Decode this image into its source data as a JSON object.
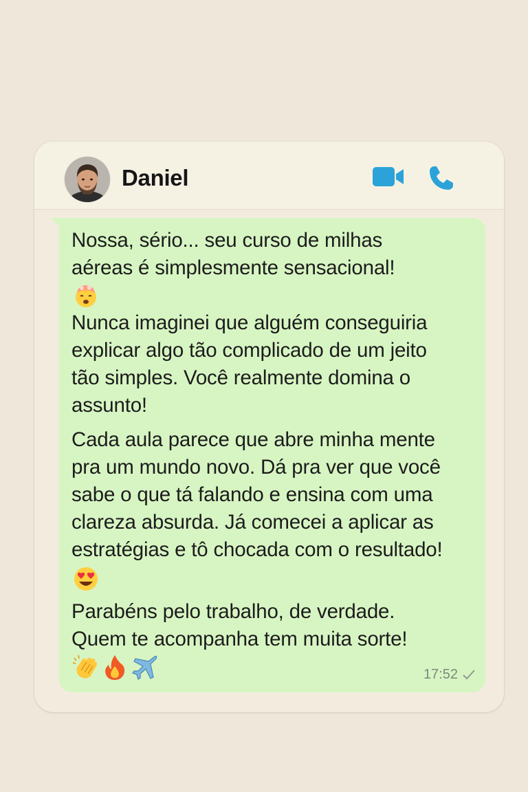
{
  "contact": {
    "name": "Daniel"
  },
  "message": {
    "paragraph_1": "Nossa, sério... seu curso de milhas\naéreas é simplesmente sensacional!\n\nNunca imaginei que alguém conseguiria\nexplicar algo tão complicado de um jeito\ntão simples. Você realmente domina o\nassunto!",
    "paragraph_2": "Cada aula parece que abre minha mente\npra um mundo novo. Dá pra ver que você\nsabe o que tá falando e ensina com uma\nclareza absurda. Já comecei a aplicar as\nestratégias e tô chocada com o resultado!",
    "paragraph_3": "Parabéns pelo trabalho, de verdade.\nQuem te acompanha tem muita sorte!",
    "time": "17:52"
  },
  "icons": {
    "video": "video-camera-icon",
    "call": "phone-icon",
    "tick": "single-check-icon",
    "emoji_1": "exploding-head-emoji",
    "emoji_2": "heart-eyes-emoji",
    "emoji_3": [
      "clapping-hands-emoji",
      "fire-emoji",
      "airplane-emoji"
    ]
  },
  "colors": {
    "accent": "#2ba3d9",
    "bubble": "#d7f5c3",
    "background": "#efe7da"
  }
}
